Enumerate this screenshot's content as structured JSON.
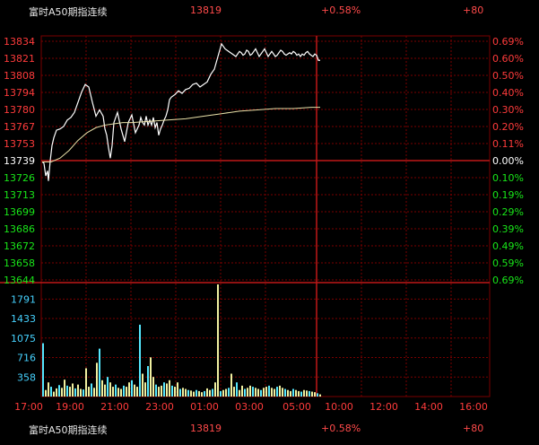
{
  "header": {
    "name": "富时A50期指连续",
    "price": "13819",
    "change": "+0.58%",
    "volume": "+80"
  },
  "footer": {
    "name": "富时A50期指连续",
    "price": "13819",
    "change": "+0.58%",
    "volume": "+80"
  },
  "colors": {
    "up": "#ff3b3b",
    "down": "#19e619",
    "grid": "#7a0000",
    "price_line": "#ffffff",
    "avg_line": "#e8e0a8",
    "volume_bar": "#f0f0a0",
    "volume_bar_alt": "#55e8ff",
    "volume_label": "#46d2ff"
  },
  "chart_data": {
    "type": "line",
    "title": "富时A50期指连续",
    "x_ticks": [
      "17:00",
      "19:00",
      "21:00",
      "23:00",
      "01:00",
      "03:00",
      "05:00",
      "10:00",
      "12:00",
      "14:00",
      "16:00"
    ],
    "prev_close": 13739,
    "price_axis_left": [
      "13834",
      "13821",
      "13808",
      "13794",
      "13780",
      "13767",
      "13753",
      "13739",
      "13726",
      "13713",
      "13699",
      "13686",
      "13672",
      "13658",
      "13644"
    ],
    "pct_axis_right": [
      "0.69%",
      "0.60%",
      "0.50%",
      "0.40%",
      "0.30%",
      "0.20%",
      "0.11%",
      "0.00%",
      "0.10%",
      "0.19%",
      "0.29%",
      "0.39%",
      "0.49%",
      "0.59%",
      "0.69%"
    ],
    "ylim": [
      13644,
      13834
    ],
    "volume_ticks": [
      "1791",
      "1433",
      "1075",
      "716",
      "358"
    ],
    "volume_ylim": [
      0,
      2060
    ],
    "series": [
      {
        "name": "price",
        "x": [
          0,
          2,
          4,
          6,
          7,
          9,
          11,
          13,
          16,
          20,
          24,
          28,
          32,
          36,
          40,
          44,
          48,
          52,
          56,
          60,
          64,
          68,
          70,
          72,
          74,
          76,
          78,
          80,
          84,
          88,
          92,
          96,
          100,
          104,
          108,
          110,
          112,
          114,
          116,
          118,
          120,
          122,
          124,
          126,
          128,
          130,
          132,
          134,
          136,
          138,
          140,
          142,
          144,
          148,
          152,
          156,
          160,
          164,
          168,
          172,
          176,
          180,
          184,
          188,
          192,
          196,
          200,
          204,
          208,
          212,
          216,
          220,
          222,
          224,
          226,
          228,
          230,
          232,
          234,
          236,
          238,
          240,
          242,
          244,
          246,
          248,
          250,
          252,
          254,
          256,
          258,
          260,
          262,
          264,
          266,
          268,
          270,
          272,
          274,
          276,
          278,
          280,
          282,
          284,
          286,
          288,
          290,
          292,
          294,
          296,
          298,
          300,
          302,
          304,
          306,
          308,
          310
        ],
        "values": [
          13739,
          13738,
          13728,
          13732,
          13724,
          13740,
          13752,
          13758,
          13764,
          13765,
          13767,
          13772,
          13774,
          13778,
          13786,
          13794,
          13800,
          13798,
          13786,
          13775,
          13780,
          13775,
          13765,
          13760,
          13750,
          13742,
          13752,
          13770,
          13778,
          13765,
          13755,
          13770,
          13776,
          13762,
          13768,
          13774,
          13770,
          13768,
          13775,
          13768,
          13772,
          13768,
          13774,
          13766,
          13770,
          13760,
          13765,
          13768,
          13772,
          13775,
          13780,
          13788,
          13790,
          13792,
          13795,
          13793,
          13796,
          13797,
          13800,
          13801,
          13798,
          13800,
          13802,
          13808,
          13812,
          13822,
          13832,
          13828,
          13826,
          13824,
          13822,
          13826,
          13825,
          13823,
          13824,
          13827,
          13826,
          13823,
          13824,
          13826,
          13828,
          13825,
          13822,
          13824,
          13826,
          13828,
          13825,
          13822,
          13824,
          13826,
          13824,
          13822,
          13823,
          13825,
          13827,
          13826,
          13824,
          13823,
          13824,
          13825,
          13824,
          13826,
          13825,
          13823,
          13824,
          13822,
          13824,
          13823,
          13825,
          13826,
          13824,
          13823,
          13822,
          13824,
          13823,
          13819,
          13819
        ]
      },
      {
        "name": "average",
        "x": [
          0,
          10,
          20,
          30,
          40,
          50,
          60,
          70,
          80,
          90,
          100,
          120,
          140,
          160,
          180,
          200,
          220,
          240,
          260,
          280,
          300,
          310
        ],
        "values": [
          13739,
          13739,
          13742,
          13748,
          13756,
          13762,
          13766,
          13768,
          13769,
          13770,
          13770,
          13771,
          13772,
          13773,
          13775,
          13777,
          13779,
          13780,
          13781,
          13781,
          13782,
          13782
        ]
      }
    ],
    "volume": {
      "x": [
        0,
        3,
        6,
        9,
        12,
        15,
        18,
        21,
        24,
        27,
        30,
        33,
        36,
        39,
        42,
        45,
        48,
        51,
        54,
        57,
        60,
        63,
        66,
        69,
        72,
        75,
        78,
        81,
        84,
        87,
        90,
        93,
        96,
        99,
        102,
        105,
        108,
        111,
        114,
        117,
        120,
        123,
        126,
        129,
        132,
        135,
        138,
        141,
        144,
        147,
        150,
        153,
        156,
        159,
        162,
        165,
        168,
        171,
        174,
        177,
        180,
        183,
        186,
        189,
        192,
        195,
        198,
        201,
        204,
        207,
        210,
        213,
        216,
        219,
        222,
        225,
        228,
        231,
        234,
        237,
        240,
        243,
        246,
        249,
        252,
        255,
        258,
        261,
        264,
        267,
        270,
        273,
        276,
        279,
        282,
        285,
        288,
        291,
        294,
        297,
        300,
        303,
        306,
        309
      ],
      "values": [
        980,
        120,
        260,
        180,
        90,
        150,
        210,
        160,
        310,
        200,
        180,
        240,
        150,
        220,
        140,
        130,
        520,
        180,
        240,
        160,
        620,
        880,
        300,
        220,
        360,
        260,
        180,
        220,
        160,
        140,
        200,
        180,
        260,
        300,
        220,
        180,
        1320,
        420,
        260,
        560,
        720,
        360,
        220,
        180,
        200,
        260,
        240,
        300,
        200,
        180,
        260,
        140,
        160,
        140,
        120,
        110,
        90,
        120,
        100,
        80,
        100,
        150,
        120,
        140,
        260,
        2060,
        100,
        120,
        140,
        160,
        420,
        180,
        260,
        120,
        200,
        140,
        160,
        200,
        180,
        160,
        140,
        120,
        160,
        180,
        200,
        160,
        140,
        180,
        200,
        160,
        140,
        120,
        100,
        140,
        120,
        100,
        90,
        120,
        110,
        100,
        90,
        80,
        60,
        40
      ]
    }
  }
}
